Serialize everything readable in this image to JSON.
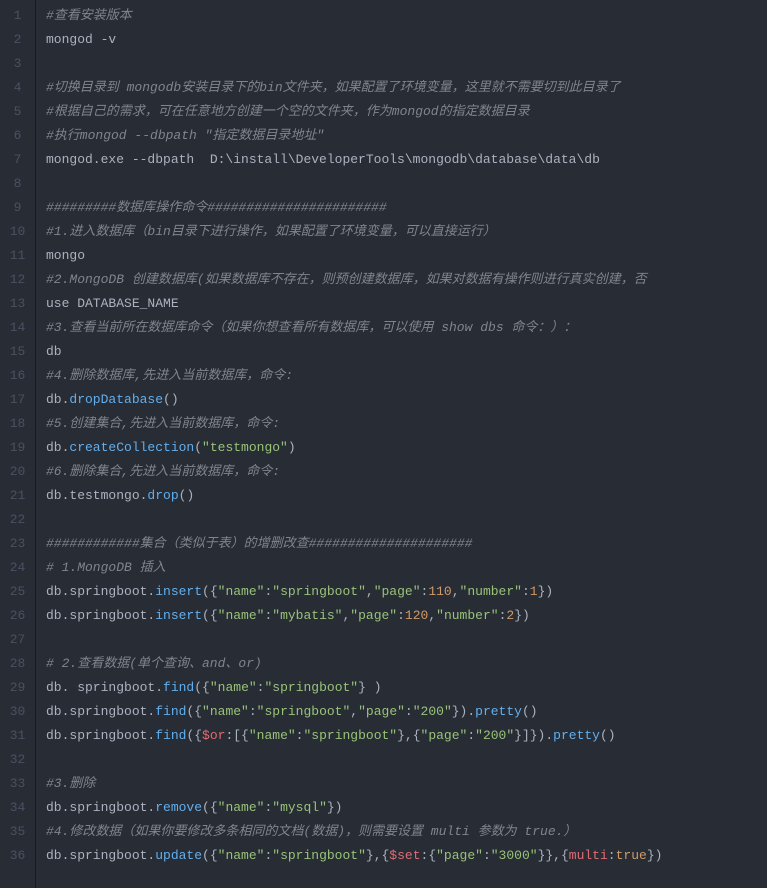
{
  "editor": {
    "theme": {
      "background": "#282c34",
      "foreground": "#abb2bf",
      "comment": "#7f848e",
      "string": "#98c379",
      "key": "#e06c75",
      "keyword": "#c678dd",
      "number": "#d19a66",
      "function": "#61afef",
      "gutter_border": "#181a1f",
      "lineno": "#495162"
    },
    "line_count": 36,
    "lines": [
      {
        "n": 1,
        "tokens": [
          {
            "t": "#查看安装版本",
            "c": "comment"
          }
        ]
      },
      {
        "n": 2,
        "tokens": [
          {
            "t": "mongod -v",
            "c": "plain"
          }
        ]
      },
      {
        "n": 3,
        "tokens": []
      },
      {
        "n": 4,
        "tokens": [
          {
            "t": "#切换目录到 mongodb安装目录下的bin文件夹，如果配置了环境变量，这里就不需要切到此目录了",
            "c": "comment"
          }
        ]
      },
      {
        "n": 5,
        "tokens": [
          {
            "t": "#根据自己的需求，可在任意地方创建一个空的文件夹，作为mongod的指定数据目录",
            "c": "comment"
          }
        ]
      },
      {
        "n": 6,
        "tokens": [
          {
            "t": "#执行mongod --dbpath \"指定数据目录地址\"",
            "c": "comment"
          }
        ]
      },
      {
        "n": 7,
        "tokens": [
          {
            "t": "mongod.exe --dbpath  D:\\install\\DeveloperTools\\mongodb\\database\\data\\db",
            "c": "plain"
          }
        ]
      },
      {
        "n": 8,
        "tokens": []
      },
      {
        "n": 9,
        "tokens": [
          {
            "t": "#########数据库操作命令#######################",
            "c": "comment"
          }
        ]
      },
      {
        "n": 10,
        "tokens": [
          {
            "t": "#1.进入数据库（bin目录下进行操作，如果配置了环境变量，可以直接运行）",
            "c": "comment"
          }
        ]
      },
      {
        "n": 11,
        "tokens": [
          {
            "t": "mongo",
            "c": "plain"
          }
        ]
      },
      {
        "n": 12,
        "tokens": [
          {
            "t": "#2.MongoDB 创建数据库(如果数据库不存在，则预创建数据库，如果对数据有操作则进行真实创建，否",
            "c": "comment"
          }
        ]
      },
      {
        "n": 13,
        "tokens": [
          {
            "t": "use DATABASE_NAME",
            "c": "plain"
          }
        ]
      },
      {
        "n": 14,
        "tokens": [
          {
            "t": "#3.查看当前所在数据库命令（如果你想查看所有数据库，可以使用 show dbs 命令：）：",
            "c": "comment"
          }
        ]
      },
      {
        "n": 15,
        "tokens": [
          {
            "t": "db",
            "c": "plain"
          }
        ]
      },
      {
        "n": 16,
        "tokens": [
          {
            "t": "#4.删除数据库,先进入当前数据库，命令:",
            "c": "comment"
          }
        ]
      },
      {
        "n": 17,
        "tokens": [
          {
            "t": "db.",
            "c": "plain"
          },
          {
            "t": "dropDatabase",
            "c": "func"
          },
          {
            "t": "()",
            "c": "plain"
          }
        ]
      },
      {
        "n": 18,
        "tokens": [
          {
            "t": "#5.创建集合,先进入当前数据库，命令:",
            "c": "comment"
          }
        ]
      },
      {
        "n": 19,
        "tokens": [
          {
            "t": "db.",
            "c": "plain"
          },
          {
            "t": "createCollection",
            "c": "func"
          },
          {
            "t": "(",
            "c": "plain"
          },
          {
            "t": "\"testmongo\"",
            "c": "string"
          },
          {
            "t": ")",
            "c": "plain"
          }
        ]
      },
      {
        "n": 20,
        "tokens": [
          {
            "t": "#6.删除集合,先进入当前数据库，命令:",
            "c": "comment"
          }
        ]
      },
      {
        "n": 21,
        "tokens": [
          {
            "t": "db.testmongo.",
            "c": "plain"
          },
          {
            "t": "drop",
            "c": "func"
          },
          {
            "t": "()",
            "c": "plain"
          }
        ]
      },
      {
        "n": 22,
        "tokens": []
      },
      {
        "n": 23,
        "tokens": [
          {
            "t": "############集合（类似于表）的增删改查#####################",
            "c": "comment"
          }
        ]
      },
      {
        "n": 24,
        "tokens": [
          {
            "t": "# 1.MongoDB 插入",
            "c": "comment"
          }
        ]
      },
      {
        "n": 25,
        "tokens": [
          {
            "t": "db.springboot.",
            "c": "plain"
          },
          {
            "t": "insert",
            "c": "func"
          },
          {
            "t": "({",
            "c": "plain"
          },
          {
            "t": "\"name\"",
            "c": "string"
          },
          {
            "t": ":",
            "c": "plain"
          },
          {
            "t": "\"springboot\"",
            "c": "string"
          },
          {
            "t": ",",
            "c": "plain"
          },
          {
            "t": "\"page\"",
            "c": "string"
          },
          {
            "t": ":",
            "c": "plain"
          },
          {
            "t": "110",
            "c": "num"
          },
          {
            "t": ",",
            "c": "plain"
          },
          {
            "t": "\"number\"",
            "c": "string"
          },
          {
            "t": ":",
            "c": "plain"
          },
          {
            "t": "1",
            "c": "num"
          },
          {
            "t": "})",
            "c": "plain"
          }
        ]
      },
      {
        "n": 26,
        "tokens": [
          {
            "t": "db.springboot.",
            "c": "plain"
          },
          {
            "t": "insert",
            "c": "func"
          },
          {
            "t": "({",
            "c": "plain"
          },
          {
            "t": "\"name\"",
            "c": "string"
          },
          {
            "t": ":",
            "c": "plain"
          },
          {
            "t": "\"mybatis\"",
            "c": "string"
          },
          {
            "t": ",",
            "c": "plain"
          },
          {
            "t": "\"page\"",
            "c": "string"
          },
          {
            "t": ":",
            "c": "plain"
          },
          {
            "t": "120",
            "c": "num"
          },
          {
            "t": ",",
            "c": "plain"
          },
          {
            "t": "\"number\"",
            "c": "string"
          },
          {
            "t": ":",
            "c": "plain"
          },
          {
            "t": "2",
            "c": "num"
          },
          {
            "t": "})",
            "c": "plain"
          }
        ]
      },
      {
        "n": 27,
        "tokens": []
      },
      {
        "n": 28,
        "tokens": [
          {
            "t": "# 2.查看数据(单个查询、and、or)",
            "c": "comment"
          }
        ]
      },
      {
        "n": 29,
        "tokens": [
          {
            "t": "db. springboot.",
            "c": "plain"
          },
          {
            "t": "find",
            "c": "func"
          },
          {
            "t": "({",
            "c": "plain"
          },
          {
            "t": "\"name\"",
            "c": "string"
          },
          {
            "t": ":",
            "c": "plain"
          },
          {
            "t": "\"springboot\"",
            "c": "string"
          },
          {
            "t": "} )",
            "c": "plain"
          }
        ]
      },
      {
        "n": 30,
        "tokens": [
          {
            "t": "db.springboot.",
            "c": "plain"
          },
          {
            "t": "find",
            "c": "func"
          },
          {
            "t": "({",
            "c": "plain"
          },
          {
            "t": "\"name\"",
            "c": "string"
          },
          {
            "t": ":",
            "c": "plain"
          },
          {
            "t": "\"springboot\"",
            "c": "string"
          },
          {
            "t": ",",
            "c": "plain"
          },
          {
            "t": "\"page\"",
            "c": "string"
          },
          {
            "t": ":",
            "c": "plain"
          },
          {
            "t": "\"200\"",
            "c": "string"
          },
          {
            "t": "}).",
            "c": "plain"
          },
          {
            "t": "pretty",
            "c": "func"
          },
          {
            "t": "()",
            "c": "plain"
          }
        ]
      },
      {
        "n": 31,
        "tokens": [
          {
            "t": "db.springboot.",
            "c": "plain"
          },
          {
            "t": "find",
            "c": "func"
          },
          {
            "t": "({",
            "c": "plain"
          },
          {
            "t": "$or",
            "c": "var"
          },
          {
            "t": ":[{",
            "c": "plain"
          },
          {
            "t": "\"name\"",
            "c": "string"
          },
          {
            "t": ":",
            "c": "plain"
          },
          {
            "t": "\"springboot\"",
            "c": "string"
          },
          {
            "t": "},{",
            "c": "plain"
          },
          {
            "t": "\"page\"",
            "c": "string"
          },
          {
            "t": ":",
            "c": "plain"
          },
          {
            "t": "\"200\"",
            "c": "string"
          },
          {
            "t": "}]}).",
            "c": "plain"
          },
          {
            "t": "pretty",
            "c": "func"
          },
          {
            "t": "()",
            "c": "plain"
          }
        ]
      },
      {
        "n": 32,
        "tokens": []
      },
      {
        "n": 33,
        "tokens": [
          {
            "t": "#3.删除",
            "c": "comment"
          }
        ]
      },
      {
        "n": 34,
        "tokens": [
          {
            "t": "db.springboot.",
            "c": "plain"
          },
          {
            "t": "remove",
            "c": "func"
          },
          {
            "t": "({",
            "c": "plain"
          },
          {
            "t": "\"name\"",
            "c": "string"
          },
          {
            "t": ":",
            "c": "plain"
          },
          {
            "t": "\"mysql\"",
            "c": "string"
          },
          {
            "t": "})",
            "c": "plain"
          }
        ]
      },
      {
        "n": 35,
        "tokens": [
          {
            "t": "#4.修改数据（如果你要修改多条相同的文档(数据)，则需要设置 multi 参数为 true.）",
            "c": "comment"
          }
        ]
      },
      {
        "n": 36,
        "tokens": [
          {
            "t": "db.springboot.",
            "c": "plain"
          },
          {
            "t": "update",
            "c": "func"
          },
          {
            "t": "({",
            "c": "plain"
          },
          {
            "t": "\"name\"",
            "c": "string"
          },
          {
            "t": ":",
            "c": "plain"
          },
          {
            "t": "\"springboot\"",
            "c": "string"
          },
          {
            "t": "},{",
            "c": "plain"
          },
          {
            "t": "$set",
            "c": "var"
          },
          {
            "t": ":{",
            "c": "plain"
          },
          {
            "t": "\"page\"",
            "c": "string"
          },
          {
            "t": ":",
            "c": "plain"
          },
          {
            "t": "\"3000\"",
            "c": "string"
          },
          {
            "t": "}},{",
            "c": "plain"
          },
          {
            "t": "multi",
            "c": "prop"
          },
          {
            "t": ":",
            "c": "plain"
          },
          {
            "t": "true",
            "c": "bool"
          },
          {
            "t": "})",
            "c": "plain"
          }
        ]
      }
    ]
  }
}
